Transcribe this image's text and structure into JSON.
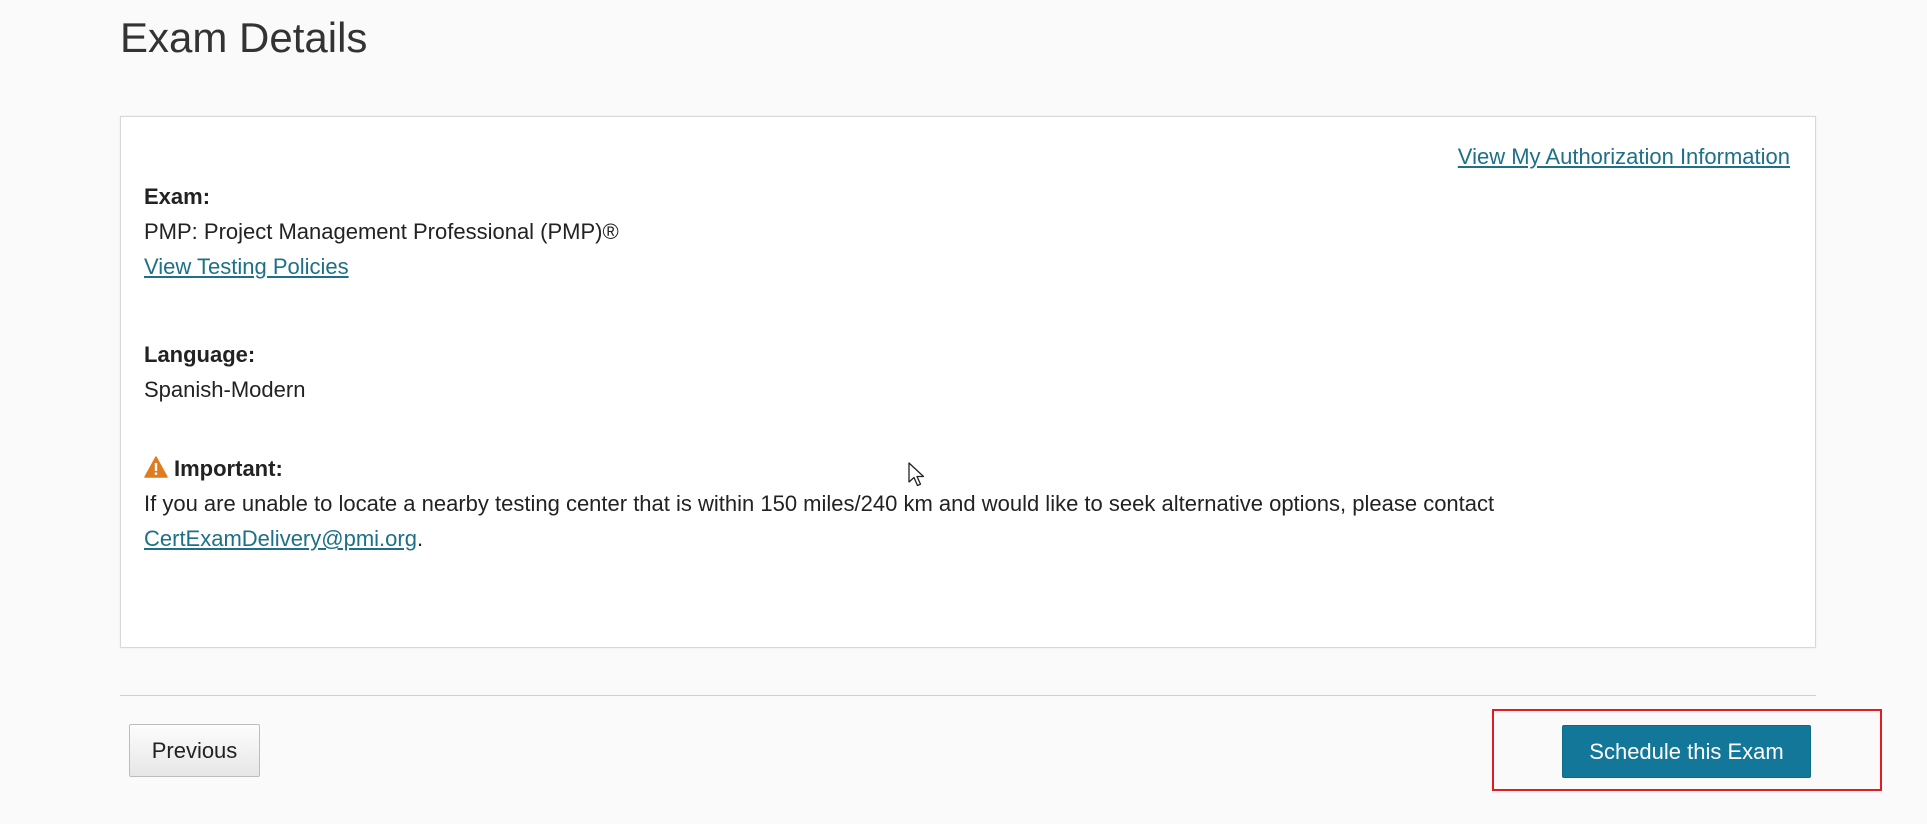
{
  "page": {
    "title": "Exam Details"
  },
  "card": {
    "auth_link": "View My Authorization Information",
    "exam": {
      "label": "Exam:",
      "value": "PMP: Project Management Professional (PMP)®",
      "policies_link": "View Testing Policies"
    },
    "language": {
      "label": "Language:",
      "value": "Spanish-Modern"
    },
    "important": {
      "icon": "warning-icon",
      "label": "Important:",
      "text": "If you are unable to locate a nearby testing center that is within 150 miles/240 km and would like to seek alternative options, please contact",
      "email_link": "CertExamDelivery@pmi.org",
      "trailing": "."
    }
  },
  "footer": {
    "previous_label": "Previous",
    "schedule_label": "Schedule this Exam"
  },
  "colors": {
    "link": "#1d7088",
    "primary_button": "#13779a",
    "highlight": "#e01b24",
    "warning": "#e07b20"
  }
}
